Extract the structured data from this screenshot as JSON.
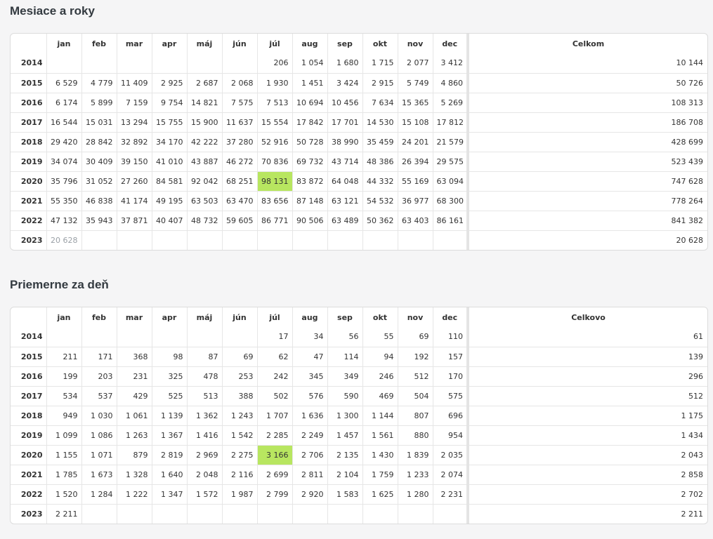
{
  "sections": [
    {
      "title": "Mesiace a roky",
      "headers": [
        "",
        "jan",
        "feb",
        "mar",
        "apr",
        "máj",
        "jún",
        "júl",
        "aug",
        "sep",
        "okt",
        "nov",
        "dec",
        "Celkom"
      ],
      "rows": [
        {
          "year": "2014",
          "cells": [
            "",
            "",
            "",
            "",
            "",
            "",
            "206",
            "1 054",
            "1 680",
            "1 715",
            "2 077",
            "3 412"
          ],
          "total": "10 144"
        },
        {
          "year": "2015",
          "cells": [
            "6 529",
            "4 779",
            "11 409",
            "2 925",
            "2 687",
            "2 068",
            "1 930",
            "1 451",
            "3 424",
            "2 915",
            "5 749",
            "4 860"
          ],
          "total": "50 726"
        },
        {
          "year": "2016",
          "cells": [
            "6 174",
            "5 899",
            "7 159",
            "9 754",
            "14 821",
            "7 575",
            "7 513",
            "10 694",
            "10 456",
            "7 634",
            "15 365",
            "5 269"
          ],
          "total": "108 313"
        },
        {
          "year": "2017",
          "cells": [
            "16 544",
            "15 031",
            "13 294",
            "15 755",
            "15 900",
            "11 637",
            "15 554",
            "17 842",
            "17 701",
            "14 530",
            "15 108",
            "17 812"
          ],
          "total": "186 708"
        },
        {
          "year": "2018",
          "cells": [
            "29 420",
            "28 842",
            "32 892",
            "34 170",
            "42 222",
            "37 280",
            "52 916",
            "50 728",
            "38 990",
            "35 459",
            "24 201",
            "21 579"
          ],
          "total": "428 699"
        },
        {
          "year": "2019",
          "cells": [
            "34 074",
            "30 409",
            "39 150",
            "41 010",
            "43 887",
            "46 272",
            "70 836",
            "69 732",
            "43 714",
            "48 386",
            "26 394",
            "29 575"
          ],
          "total": "523 439"
        },
        {
          "year": "2020",
          "cells": [
            "35 796",
            "31 052",
            "27 260",
            "84 581",
            "92 042",
            "68 251",
            "98 131",
            "83 872",
            "64 048",
            "44 332",
            "55 169",
            "63 094"
          ],
          "total": "747 628"
        },
        {
          "year": "2021",
          "cells": [
            "55 350",
            "46 838",
            "41 174",
            "49 195",
            "63 503",
            "63 470",
            "83 656",
            "87 148",
            "63 121",
            "54 532",
            "36 977",
            "68 300"
          ],
          "total": "778 264"
        },
        {
          "year": "2022",
          "cells": [
            "47 132",
            "35 943",
            "37 871",
            "40 407",
            "48 732",
            "59 605",
            "86 771",
            "90 506",
            "63 489",
            "50 362",
            "63 403",
            "86 161"
          ],
          "total": "841 382"
        },
        {
          "year": "2023",
          "cells": [
            "20 628",
            "",
            "",
            "",
            "",
            "",
            "",
            "",
            "",
            "",
            "",
            ""
          ],
          "total": "20 628"
        }
      ],
      "highlight": {
        "row": 6,
        "col": 6,
        "color": "#b8e660"
      },
      "muted": {
        "row": 9,
        "col": 0,
        "color": "#9aa0a6"
      }
    },
    {
      "title": "Priemerne za deň",
      "headers": [
        "",
        "jan",
        "feb",
        "mar",
        "apr",
        "máj",
        "jún",
        "júl",
        "aug",
        "sep",
        "okt",
        "nov",
        "dec",
        "Celkovo"
      ],
      "rows": [
        {
          "year": "2014",
          "cells": [
            "",
            "",
            "",
            "",
            "",
            "",
            "17",
            "34",
            "56",
            "55",
            "69",
            "110"
          ],
          "total": "61"
        },
        {
          "year": "2015",
          "cells": [
            "211",
            "171",
            "368",
            "98",
            "87",
            "69",
            "62",
            "47",
            "114",
            "94",
            "192",
            "157"
          ],
          "total": "139"
        },
        {
          "year": "2016",
          "cells": [
            "199",
            "203",
            "231",
            "325",
            "478",
            "253",
            "242",
            "345",
            "349",
            "246",
            "512",
            "170"
          ],
          "total": "296"
        },
        {
          "year": "2017",
          "cells": [
            "534",
            "537",
            "429",
            "525",
            "513",
            "388",
            "502",
            "576",
            "590",
            "469",
            "504",
            "575"
          ],
          "total": "512"
        },
        {
          "year": "2018",
          "cells": [
            "949",
            "1 030",
            "1 061",
            "1 139",
            "1 362",
            "1 243",
            "1 707",
            "1 636",
            "1 300",
            "1 144",
            "807",
            "696"
          ],
          "total": "1 175"
        },
        {
          "year": "2019",
          "cells": [
            "1 099",
            "1 086",
            "1 263",
            "1 367",
            "1 416",
            "1 542",
            "2 285",
            "2 249",
            "1 457",
            "1 561",
            "880",
            "954"
          ],
          "total": "1 434"
        },
        {
          "year": "2020",
          "cells": [
            "1 155",
            "1 071",
            "879",
            "2 819",
            "2 969",
            "2 275",
            "3 166",
            "2 706",
            "2 135",
            "1 430",
            "1 839",
            "2 035"
          ],
          "total": "2 043"
        },
        {
          "year": "2021",
          "cells": [
            "1 785",
            "1 673",
            "1 328",
            "1 640",
            "2 048",
            "2 116",
            "2 699",
            "2 811",
            "2 104",
            "1 759",
            "1 233",
            "2 074"
          ],
          "total": "2 858"
        },
        {
          "year": "2022",
          "cells": [
            "1 520",
            "1 284",
            "1 222",
            "1 347",
            "1 572",
            "1 987",
            "2 799",
            "2 920",
            "1 583",
            "1 625",
            "1 280",
            "2 231"
          ],
          "total": "2 702"
        },
        {
          "year": "2023",
          "cells": [
            "2 211",
            "",
            "",
            "",
            "",
            "",
            "",
            "",
            "",
            "",
            "",
            ""
          ],
          "total": "2 211"
        }
      ],
      "highlight": {
        "row": 6,
        "col": 6,
        "color": "#b8e660"
      }
    }
  ]
}
